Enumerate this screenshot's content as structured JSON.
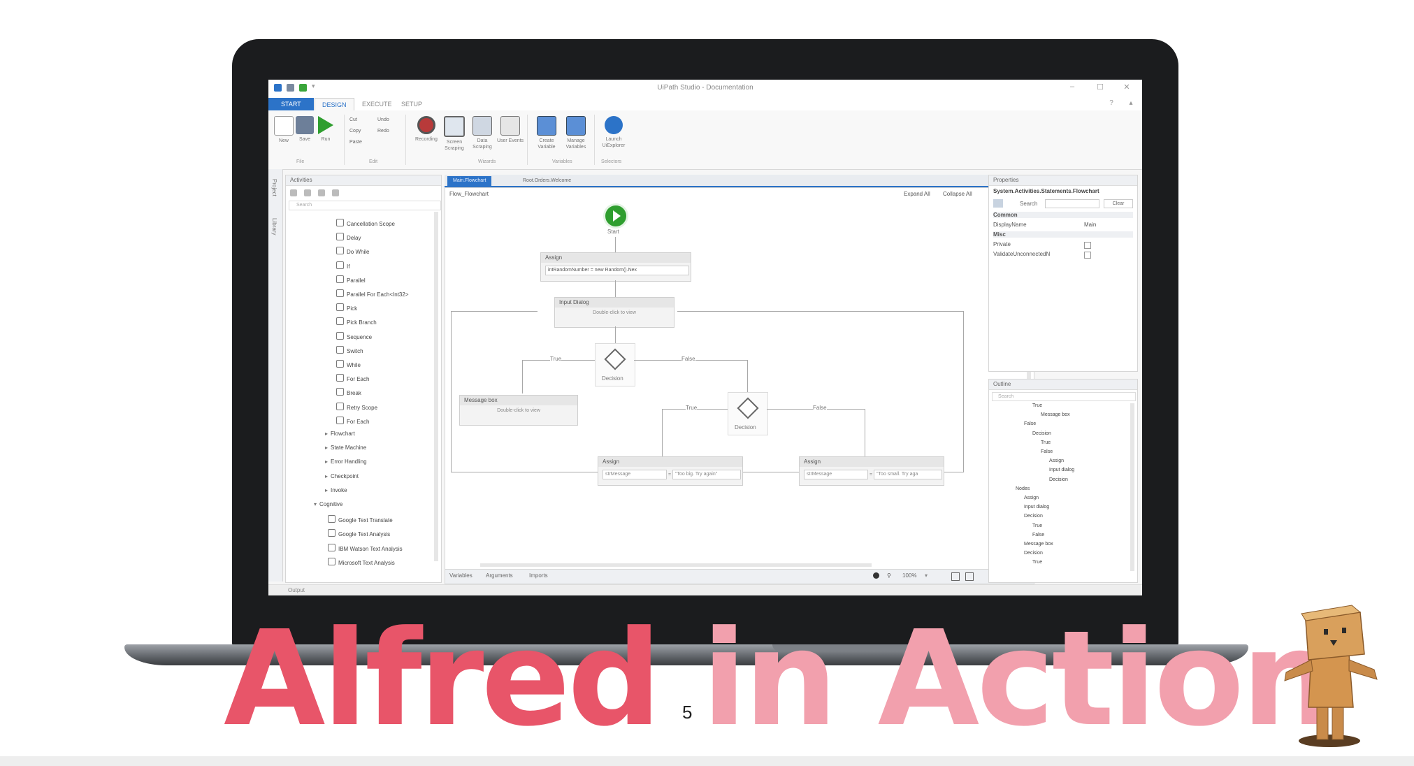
{
  "slide": {
    "title_word_1": "Alfred",
    "title_word_2": "in Action",
    "page_number": "5",
    "colors": {
      "title_strong": "#e85569",
      "title_light": "#f2a0ad"
    }
  },
  "app": {
    "window_title": "UiPath Studio - Documentation",
    "ribbon_tabs": [
      "START",
      "DESIGN",
      "EXECUTE",
      "SETUP"
    ],
    "ribbon_buttons": [
      {
        "label": "New"
      },
      {
        "label": "Save"
      },
      {
        "label": "Run"
      },
      {
        "label": "Recording"
      },
      {
        "label": "Screen Scraping"
      },
      {
        "label": "Data Scraping"
      },
      {
        "label": "User Events"
      },
      {
        "label": "Create Variable"
      },
      {
        "label": "Manage Variables"
      },
      {
        "label": "Launch UiExplorer"
      }
    ],
    "ribbon_small": [
      "Cut",
      "Copy",
      "Paste",
      "Undo",
      "Redo"
    ],
    "ribbon_groups": [
      "File",
      "Edit",
      "Wizards",
      "Variables",
      "Selectors"
    ],
    "activities_panel": {
      "title": "Activities",
      "search_placeholder": "Search",
      "items": [
        {
          "label": "Cancellation Scope",
          "kind": "item"
        },
        {
          "label": "Delay",
          "kind": "item"
        },
        {
          "label": "Do While",
          "kind": "item"
        },
        {
          "label": "If",
          "kind": "item"
        },
        {
          "label": "Parallel",
          "kind": "item"
        },
        {
          "label": "Parallel For Each<Int32>",
          "kind": "item"
        },
        {
          "label": "Pick",
          "kind": "item"
        },
        {
          "label": "Pick Branch",
          "kind": "item"
        },
        {
          "label": "Sequence",
          "kind": "item"
        },
        {
          "label": "Switch",
          "kind": "item"
        },
        {
          "label": "While",
          "kind": "item"
        },
        {
          "label": "For Each",
          "kind": "item"
        },
        {
          "label": "Break",
          "kind": "item"
        },
        {
          "label": "Retry Scope",
          "kind": "item"
        },
        {
          "label": "For Each",
          "kind": "item"
        },
        {
          "label": "Flowchart",
          "kind": "group"
        },
        {
          "label": "State Machine",
          "kind": "group"
        },
        {
          "label": "Error Handling",
          "kind": "group"
        },
        {
          "label": "Checkpoint",
          "kind": "group"
        },
        {
          "label": "Invoke",
          "kind": "group"
        },
        {
          "label": "Cognitive",
          "kind": "open"
        },
        {
          "label": "Google Text Translate",
          "kind": "item"
        },
        {
          "label": "Google Text Analysis",
          "kind": "item"
        },
        {
          "label": "IBM Watson Text Analysis",
          "kind": "item"
        },
        {
          "label": "Microsoft Text Analysis",
          "kind": "item"
        }
      ],
      "side_tabs": [
        "Project",
        "Library"
      ]
    },
    "document_tabs": [
      "Main.Flowchart",
      "Root.Orders.Welcome"
    ],
    "designer": {
      "breadcrumb": "Flow_Flowchart",
      "expand_all": "Expand All",
      "collapse_all": "Collapse All",
      "start_label": "Start",
      "assign1_header": "Assign",
      "assign1_expr": "intRandomNumber = new Random().Nex",
      "input_dialog_header": "Input Dialog",
      "input_dialog_body": "Double-click to view",
      "decision_label": "Decision",
      "true_label": "True",
      "false_label": "False",
      "message_box_header": "Message box",
      "message_box_body": "Double-click to view",
      "assign2_header": "Assign",
      "assign2_left": "strMessage",
      "assign2_right": "\"Too big. Try again\"",
      "assign3_header": "Assign",
      "assign3_left": "strMessage",
      "assign3_right": "\"Too small. Try aga"
    },
    "designer_bottom": {
      "tabs": [
        "Variables",
        "Arguments",
        "Imports"
      ],
      "zoom": "100%"
    },
    "properties_panel": {
      "title": "Properties",
      "subject": "System.Activities.Statements.Flowchart",
      "search_label": "Search",
      "clear_label": "Clear",
      "sections": [
        "Common",
        "Misc"
      ],
      "rows": [
        {
          "name": "DisplayName",
          "value": "Main"
        },
        {
          "name": "Private",
          "value": ""
        },
        {
          "name": "ValidateUnconnectedN",
          "value": ""
        }
      ]
    },
    "outline_panel": {
      "title": "Outline",
      "search_placeholder": "Search",
      "items": [
        {
          "label": "True",
          "depth": 3
        },
        {
          "label": "Message box",
          "depth": 4
        },
        {
          "label": "False",
          "depth": 2
        },
        {
          "label": "Decision",
          "depth": 3
        },
        {
          "label": "True",
          "depth": 4
        },
        {
          "label": "False",
          "depth": 4
        },
        {
          "label": "Assign",
          "depth": 5
        },
        {
          "label": "Input dialog",
          "depth": 5
        },
        {
          "label": "Decision",
          "depth": 5
        },
        {
          "label": "Nodes",
          "depth": 1
        },
        {
          "label": "Assign",
          "depth": 2
        },
        {
          "label": "Input dialog",
          "depth": 2
        },
        {
          "label": "Decision",
          "depth": 2
        },
        {
          "label": "True",
          "depth": 3
        },
        {
          "label": "False",
          "depth": 3
        },
        {
          "label": "Message box",
          "depth": 2
        },
        {
          "label": "Decision",
          "depth": 2
        },
        {
          "label": "True",
          "depth": 3
        }
      ]
    },
    "status_bar": "Output"
  }
}
